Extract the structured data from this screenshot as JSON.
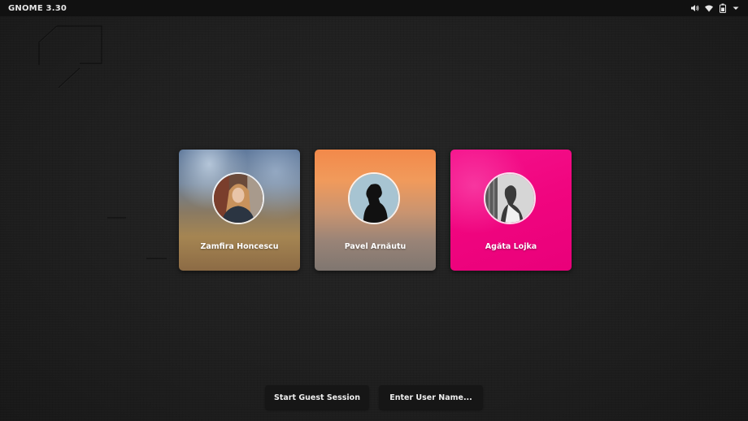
{
  "topbar": {
    "title": "GNOME 3.30",
    "tray": {
      "volume_icon": "volume-icon",
      "wifi_icon": "wifi-icon",
      "battery_icon": "battery-icon",
      "menu_icon": "chevron-down-icon"
    }
  },
  "users": [
    {
      "name": "Zamfira Honcescu",
      "avatar": "avatar-photo-woman"
    },
    {
      "name": "Pavel Arnăutu",
      "avatar": "avatar-silhouette"
    },
    {
      "name": "Agăta Lojka",
      "avatar": "avatar-photo-bw"
    }
  ],
  "buttons": {
    "guest_label": "Start Guest Session",
    "enter_label": "Enter User Name..."
  },
  "colors": {
    "topbar_bg": "#111111",
    "background": "#1e1e1e",
    "button_bg": "#161616",
    "card3_accent": "#f0057f"
  }
}
